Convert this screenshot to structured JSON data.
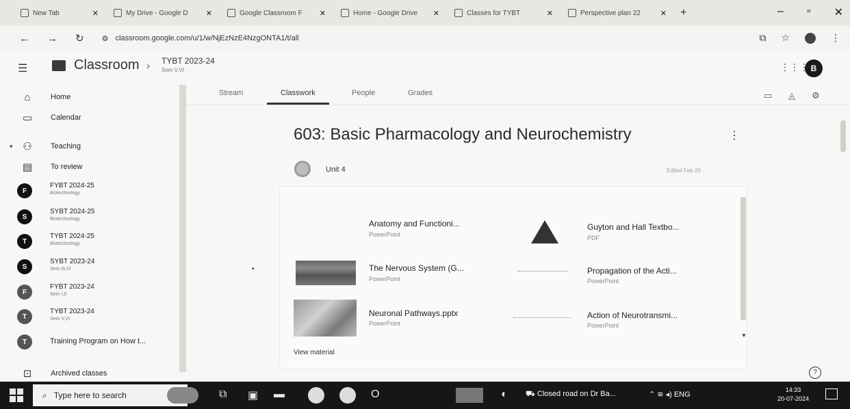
{
  "browser": {
    "tabs": [
      {
        "title": "New Tab"
      },
      {
        "title": "My Drive - Google D"
      },
      {
        "title": "Google Classroom F"
      },
      {
        "title": "Home - Google Drive"
      },
      {
        "title": "Classes for TYBT"
      },
      {
        "title": "Perspective plan 22"
      }
    ],
    "new_tab": "+",
    "url": "classroom.google.com/u/1/w/NjEzNzE4NzgONTA1/t/all"
  },
  "header": {
    "brand": "Classroom",
    "breadcrumb_sep": "›",
    "class_title": "TYBT 2023-24",
    "class_subtitle": "Sem V,VI",
    "avatar_letter": "B"
  },
  "sidebar": {
    "home": "Home",
    "calendar": "Calendar",
    "teaching": "Teaching",
    "to_review": "To review",
    "classes": [
      {
        "letter": "F",
        "name": "FYBT 2024-25",
        "sub": "Biotechnology"
      },
      {
        "letter": "S",
        "name": "SYBT 2024-25",
        "sub": "Biotechnology"
      },
      {
        "letter": "T",
        "name": "TYBT 2024-25",
        "sub": "Biotechnology"
      },
      {
        "letter": "S",
        "name": "SYBT 2023-24",
        "sub": "Sem III,IV"
      },
      {
        "letter": "F",
        "name": "FYBT 2023-24",
        "sub": "Sem I,II"
      },
      {
        "letter": "T",
        "name": "TYBT 2023-24",
        "sub": "Sem V,VI"
      },
      {
        "letter": "T",
        "name": "Training Program on How t...",
        "sub": ""
      }
    ],
    "archived": "Archived classes"
  },
  "tabs": {
    "stream": "Stream",
    "classwork": "Classwork",
    "people": "People",
    "grades": "Grades"
  },
  "main": {
    "topic_title": "603: Basic Pharmacology and Neurochemistry",
    "unit_label": "Unit 4",
    "edited": "Edited Feb 20",
    "view_material": "View material",
    "materials": [
      {
        "title": "Anatomy and Functioni...",
        "type": "PowerPoint"
      },
      {
        "title": "Guyton and Hall Textbo...",
        "type": "PDF"
      },
      {
        "title": "The Nervous System (G...",
        "type": "PowerPoint"
      },
      {
        "title": "Propagation of the Acti...",
        "type": "PowerPoint"
      },
      {
        "title": "Neuronal Pathways.pptx",
        "type": "PowerPoint"
      },
      {
        "title": "Action of Neurotransmi...",
        "type": "PowerPoint"
      }
    ]
  },
  "taskbar": {
    "search_placeholder": "Type here to search",
    "news": "Closed road on Dr Ba...",
    "lang": "ENG",
    "time": "14:33",
    "date": "20-07-2024"
  }
}
